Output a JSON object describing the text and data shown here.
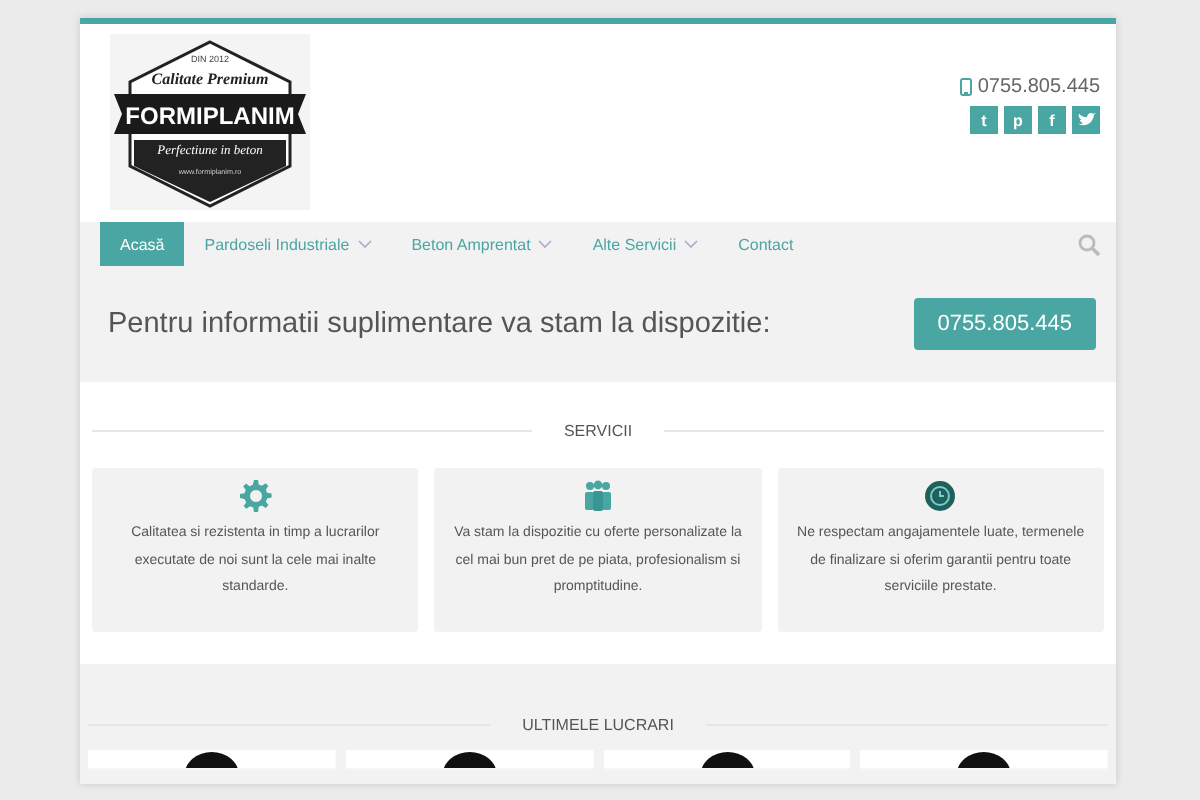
{
  "logo": {
    "since": "DIN 2012",
    "tagline": "Calitate Premium",
    "name": "FORMIPLANIM",
    "motto": "Perfectiune in beton",
    "url": "www.formiplanim.ro"
  },
  "header": {
    "phone": "0755.805.445",
    "social": [
      {
        "kind": "tumblr",
        "label": "t"
      },
      {
        "kind": "pinterest",
        "label": "p"
      },
      {
        "kind": "facebook",
        "label": "f"
      },
      {
        "kind": "twitter"
      }
    ]
  },
  "nav": {
    "items": [
      {
        "label": "Acasă",
        "selected": true,
        "dropdown": false
      },
      {
        "label": "Pardoseli Industriale",
        "selected": false,
        "dropdown": true
      },
      {
        "label": "Beton Amprentat",
        "selected": false,
        "dropdown": true
      },
      {
        "label": "Alte Servicii",
        "selected": false,
        "dropdown": true
      },
      {
        "label": "Contact",
        "selected": false,
        "dropdown": false
      }
    ]
  },
  "cta": {
    "text": "Pentru informatii suplimentare va stam la dispozitie:",
    "button": "0755.805.445"
  },
  "services": {
    "heading": "SERVICII",
    "cards": [
      {
        "kind": "gear",
        "text": "Calitatea si rezistenta in timp a lucrarilor executate de noi sunt la cele mai inalte standarde."
      },
      {
        "kind": "people",
        "text": "Va stam la dispozitie cu oferte personalizate la cel mai bun pret de pe piata, profesionalism si promptitudine."
      },
      {
        "kind": "clock",
        "text": "Ne respectam angajamentele luate, termenele de finalizare si oferim garantii pentru toate serviciile prestate."
      }
    ]
  },
  "works": {
    "heading": "ULTIMELE LUCRARI"
  }
}
